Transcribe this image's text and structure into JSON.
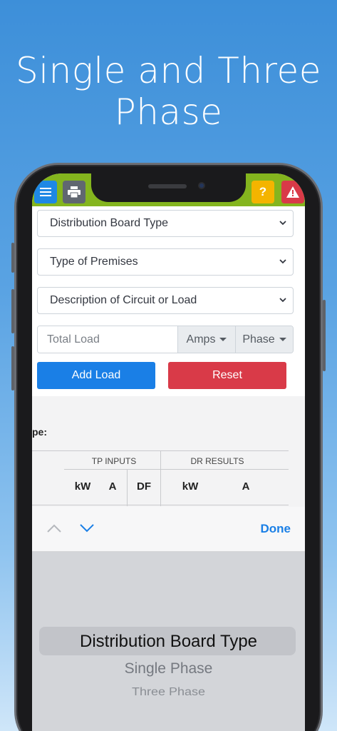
{
  "headline": {
    "line1": "Single and Three",
    "line2": "Phase"
  },
  "topbar": {
    "menu_icon": "hamburger-menu-icon",
    "print_icon": "printer-icon",
    "help_label": "?",
    "warning_icon": "warning-triangle-icon",
    "bar_color": "#84b51e"
  },
  "form": {
    "selects": [
      {
        "value": "Distribution Board Type"
      },
      {
        "value": "Type of Premises"
      },
      {
        "value": "Description of Circuit or Load"
      }
    ],
    "total_load_placeholder": "Total Load",
    "amps_label": "Amps",
    "phase_label": "Phase",
    "add_label": "Add Load",
    "reset_label": "Reset"
  },
  "results": {
    "label_fragment": "pe:",
    "groups": [
      "TP INPUTS",
      "DR RESULTS"
    ],
    "tp_columns": [
      "kW",
      "A",
      "DF"
    ],
    "dr_columns": [
      "kW",
      "A"
    ]
  },
  "keyboard_toolbar": {
    "done_label": "Done"
  },
  "picker": {
    "options": [
      "Distribution Board Type",
      "Single Phase",
      "Three Phase"
    ]
  },
  "colors": {
    "primary": "#1a7fe6",
    "danger": "#d93a48",
    "warning": "#f4b400"
  }
}
